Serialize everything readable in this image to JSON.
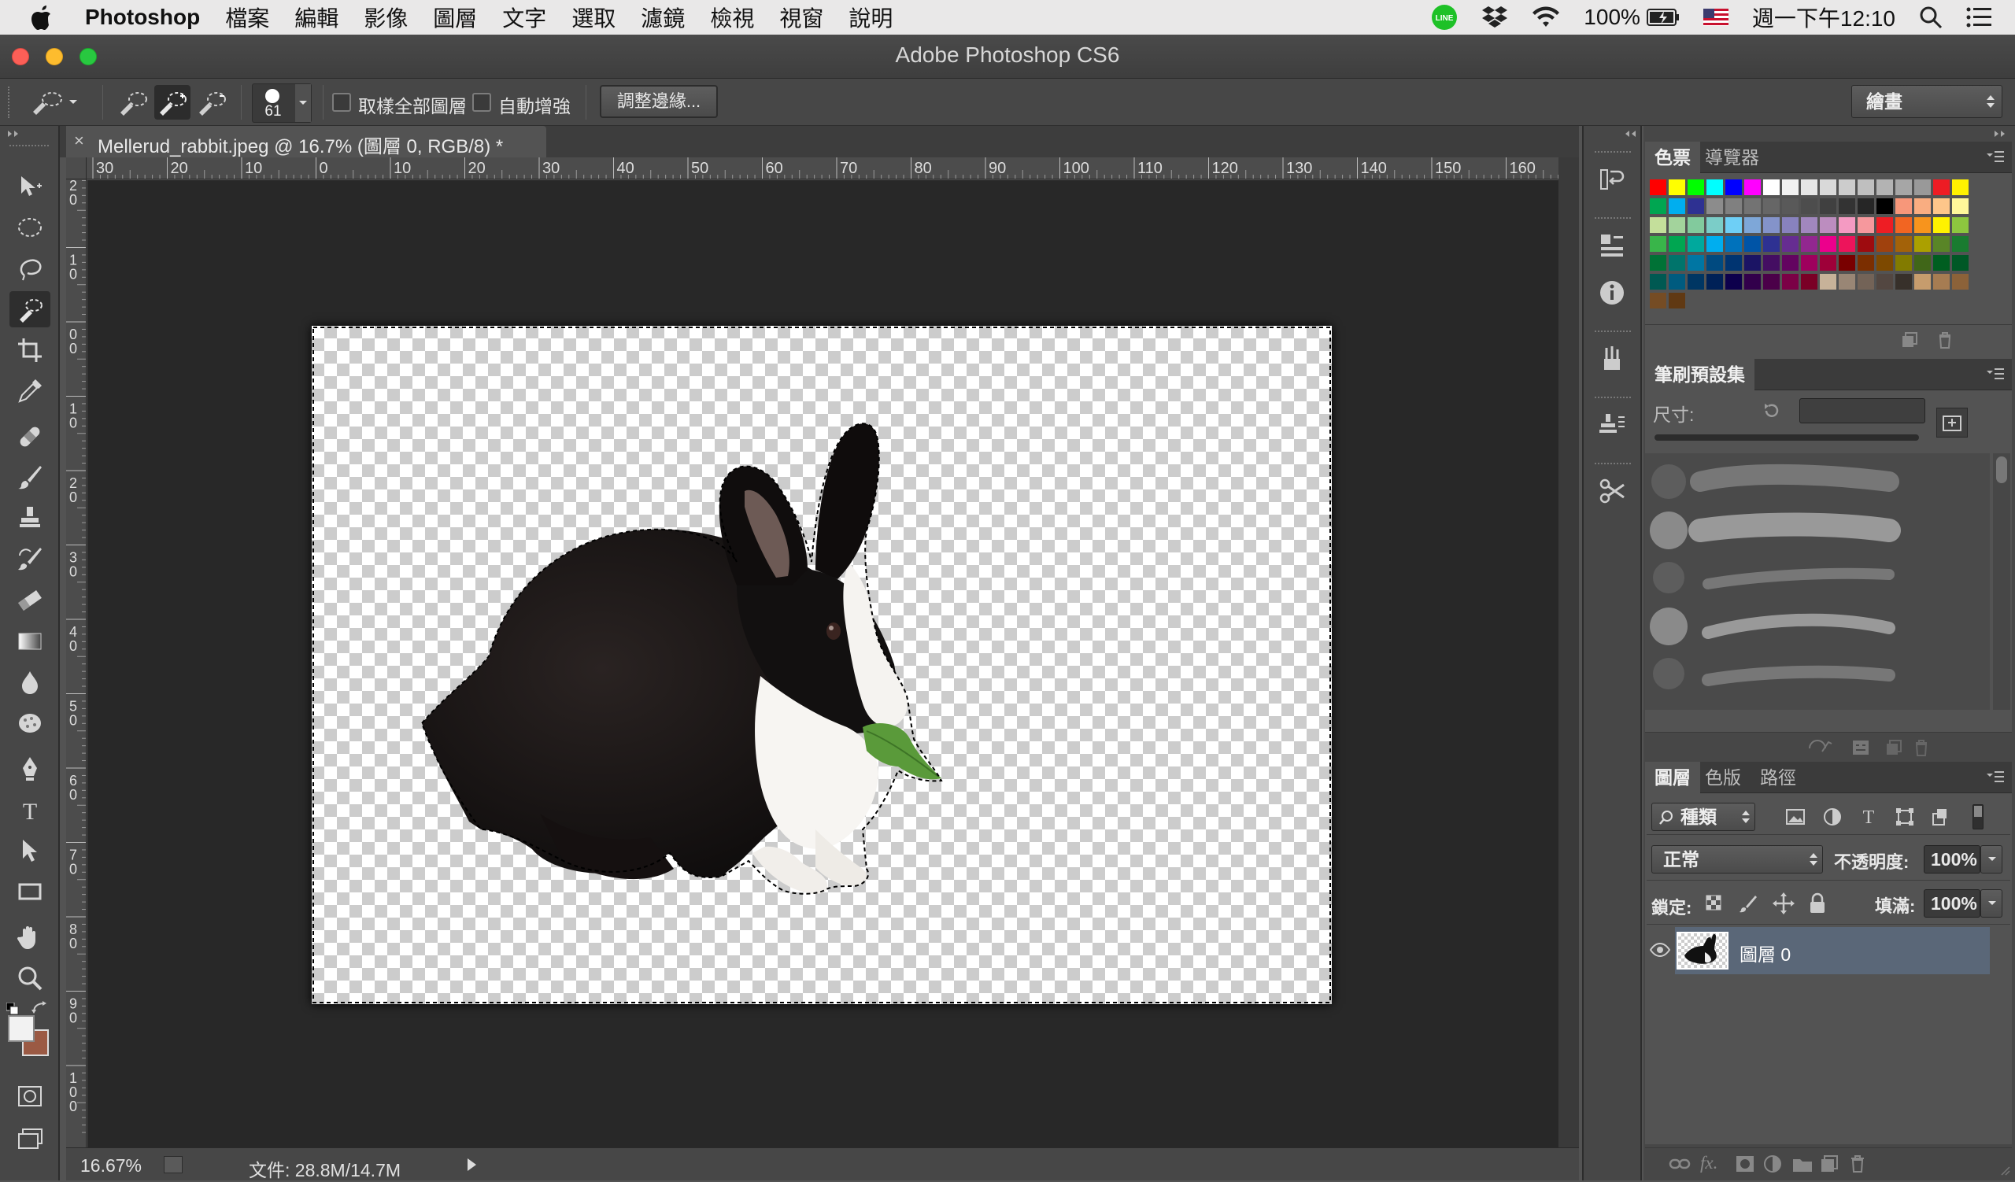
{
  "menubar": {
    "app": "Photoshop",
    "items": [
      "檔案",
      "編輯",
      "影像",
      "圖層",
      "文字",
      "選取",
      "濾鏡",
      "檢視",
      "視窗",
      "說明"
    ],
    "battery": "100%",
    "clock": "週一下午12:10"
  },
  "window": {
    "title": "Adobe Photoshop CS6"
  },
  "options": {
    "brush_size": "61",
    "sample_all_layers": "取樣全部圖層",
    "auto_enhance": "自動增強",
    "refine_edge": "調整邊緣...",
    "workspace": "繪畫"
  },
  "document": {
    "tab_title": "Mellerud_rabbit.jpeg @ 16.7% (圖層 0, RGB/8) *",
    "close_glyph": "×",
    "ruler_top": [
      "30",
      "20",
      "10",
      "0",
      "10",
      "20",
      "30",
      "40",
      "50",
      "60",
      "70",
      "80",
      "90",
      "100",
      "110",
      "120",
      "130",
      "140",
      "150",
      "160"
    ],
    "ruler_left": [
      "2",
      "1",
      "0",
      "1",
      "2",
      "3",
      "4",
      "5",
      "6",
      "7",
      "8",
      "9",
      "10"
    ],
    "zoom": "16.67%",
    "doc_info": "文件: 28.8M/14.7M"
  },
  "swatches_panel": {
    "tabs": [
      "色票",
      "導覽器"
    ],
    "colors": [
      [
        "#ff0000",
        "#ffff00",
        "#00ff00",
        "#00ffff",
        "#0000ff",
        "#ff00ff",
        "#ffffff",
        "#f2f2f2",
        "#e6e6e6",
        "#d9d9d9",
        "#cccccc",
        "#bfbfbf",
        "#b3b3b3",
        "#a6a6a6",
        "#999999",
        "#ed1c24",
        "#fff200"
      ],
      [
        "#00a651",
        "#00aeef",
        "#2e3192",
        "#8c8c8c",
        "#808080",
        "#737373",
        "#666666",
        "#595959",
        "#4d4d4d",
        "#404040",
        "#333333",
        "#262626",
        "#000000",
        "#f7977a",
        "#f9ad81",
        "#fdc68a",
        "#fff79a"
      ],
      [
        "#c4df9b",
        "#a3d39c",
        "#82ca9d",
        "#7bcdc8",
        "#6ecff6",
        "#7ea7d8",
        "#8493ca",
        "#8882be",
        "#a187be",
        "#bc8dbf",
        "#f49ac2",
        "#f6989d",
        "#ee1d24",
        "#f26522",
        "#f7941d",
        "#fff200",
        "#8dc63f"
      ],
      [
        "#39b54a",
        "#00a651",
        "#00a99d",
        "#00aeef",
        "#0072bc",
        "#0054a6",
        "#2e3192",
        "#662d91",
        "#92278f",
        "#ec008c",
        "#ed145b",
        "#9e0b0f",
        "#a0410d",
        "#a36209",
        "#aba000",
        "#598527",
        "#197b30"
      ],
      [
        "#007236",
        "#00746b",
        "#0076a3",
        "#004a80",
        "#003471",
        "#1b1464",
        "#440e62",
        "#630460",
        "#9e005d",
        "#9e0039",
        "#790000",
        "#7b2e00",
        "#7d4900",
        "#827b00",
        "#406618",
        "#005e20",
        "#005826"
      ],
      [
        "#005952",
        "#005b7f",
        "#003663",
        "#002157",
        "#0d004c",
        "#32004b",
        "#4b0049",
        "#7b0046",
        "#7a0026",
        "#c7b299",
        "#998675",
        "#736357",
        "#534741",
        "#37302a",
        "#c69c6d",
        "#a67c52",
        "#8c6239"
      ],
      [
        "#754c24",
        "#603913"
      ]
    ]
  },
  "brush_panel": {
    "tab": "筆刷預設集",
    "size_label": "尺寸:"
  },
  "layers_panel": {
    "tabs": [
      "圖層",
      "色版",
      "路徑"
    ],
    "filter": "種類",
    "blend_mode": "正常",
    "opacity_label": "不透明度:",
    "opacity": "100%",
    "lock_label": "鎖定:",
    "fill_label": "填滿:",
    "fill": "100%",
    "layers": [
      {
        "name": "圖層 0"
      }
    ],
    "fx": "fx."
  }
}
